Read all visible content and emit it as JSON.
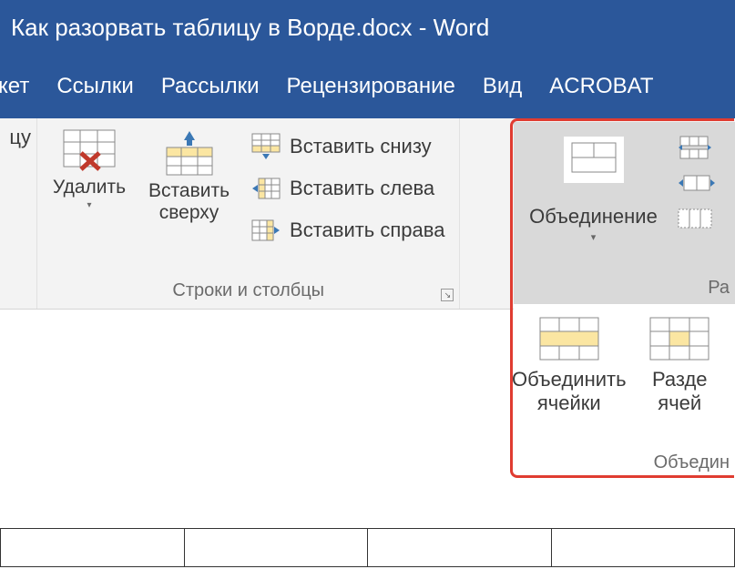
{
  "title": "Как разорвать таблицу в Ворде.docx - Word",
  "tabs": {
    "maket": "кет",
    "links": "Ссылки",
    "mailings": "Рассылки",
    "review": "Рецензирование",
    "view": "Вид",
    "acrobat": "ACROBAT"
  },
  "ribbon": {
    "left_cut": "цу",
    "delete": "Удалить",
    "insert_above": "Вставить\nсверху",
    "insert_below": "Вставить снизу",
    "insert_left": "Вставить слева",
    "insert_right": "Вставить справа",
    "rows_cols_group": "Строки и столбцы",
    "merge_dropdown": "Объединение",
    "size_group_cut": "Ра",
    "merge_cells": "Объединить\nячейки",
    "split_cells_cut": "Разде\nячей",
    "merge_group_cut": "Объедин"
  }
}
